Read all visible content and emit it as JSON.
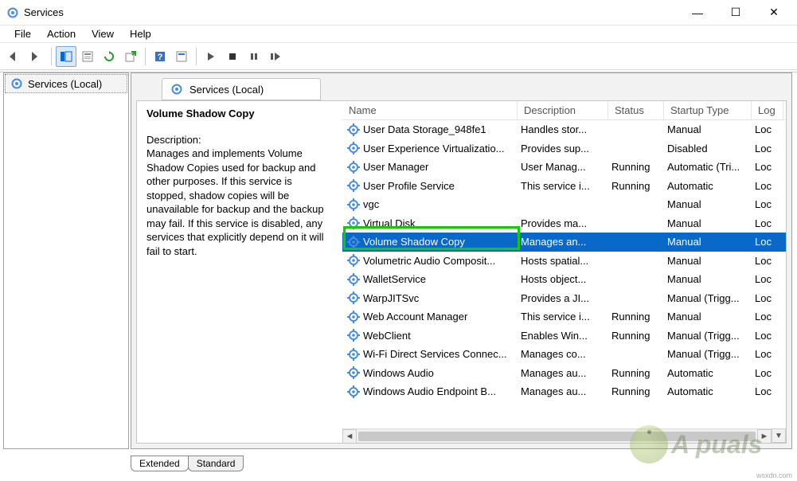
{
  "window": {
    "title": "Services"
  },
  "menu": {
    "file": "File",
    "action": "Action",
    "view": "View",
    "help": "Help"
  },
  "tree": {
    "root": "Services (Local)"
  },
  "pane": {
    "title": "Services (Local)"
  },
  "detail": {
    "title": "Volume Shadow Copy",
    "desc_label": "Description:",
    "desc": "Manages and implements Volume Shadow Copies used for backup and other purposes. If this service is stopped, shadow copies will be unavailable for backup and the backup may fail. If this service is disabled, any services that explicitly depend on it will fail to start."
  },
  "columns": {
    "name": "Name",
    "desc": "Description",
    "status": "Status",
    "start": "Startup Type",
    "log": "Log"
  },
  "rows": [
    {
      "name": "User Data Storage_948fe1",
      "desc": "Handles stor...",
      "status": "",
      "start": "Manual",
      "log": "Loc"
    },
    {
      "name": "User Experience Virtualizatio...",
      "desc": "Provides sup...",
      "status": "",
      "start": "Disabled",
      "log": "Loc"
    },
    {
      "name": "User Manager",
      "desc": "User Manag...",
      "status": "Running",
      "start": "Automatic (Tri...",
      "log": "Loc"
    },
    {
      "name": "User Profile Service",
      "desc": "This service i...",
      "status": "Running",
      "start": "Automatic",
      "log": "Loc"
    },
    {
      "name": "vgc",
      "desc": "",
      "status": "",
      "start": "Manual",
      "log": "Loc"
    },
    {
      "name": "Virtual Disk",
      "desc": "Provides ma...",
      "status": "",
      "start": "Manual",
      "log": "Loc"
    },
    {
      "name": "Volume Shadow Copy",
      "desc": "Manages an...",
      "status": "",
      "start": "Manual",
      "log": "Loc",
      "selected": true
    },
    {
      "name": "Volumetric Audio Composit...",
      "desc": "Hosts spatial...",
      "status": "",
      "start": "Manual",
      "log": "Loc"
    },
    {
      "name": "WalletService",
      "desc": "Hosts object...",
      "status": "",
      "start": "Manual",
      "log": "Loc"
    },
    {
      "name": "WarpJITSvc",
      "desc": "Provides a JI...",
      "status": "",
      "start": "Manual (Trigg...",
      "log": "Loc"
    },
    {
      "name": "Web Account Manager",
      "desc": "This service i...",
      "status": "Running",
      "start": "Manual",
      "log": "Loc"
    },
    {
      "name": "WebClient",
      "desc": "Enables Win...",
      "status": "Running",
      "start": "Manual (Trigg...",
      "log": "Loc"
    },
    {
      "name": "Wi-Fi Direct Services Connec...",
      "desc": "Manages co...",
      "status": "",
      "start": "Manual (Trigg...",
      "log": "Loc"
    },
    {
      "name": "Windows Audio",
      "desc": "Manages au...",
      "status": "Running",
      "start": "Automatic",
      "log": "Loc"
    },
    {
      "name": "Windows Audio Endpoint B...",
      "desc": "Manages au...",
      "status": "Running",
      "start": "Automatic",
      "log": "Loc"
    }
  ],
  "tabs": {
    "extended": "Extended",
    "standard": "Standard"
  },
  "footer": "wsxdn.com",
  "watermark": "A puals"
}
